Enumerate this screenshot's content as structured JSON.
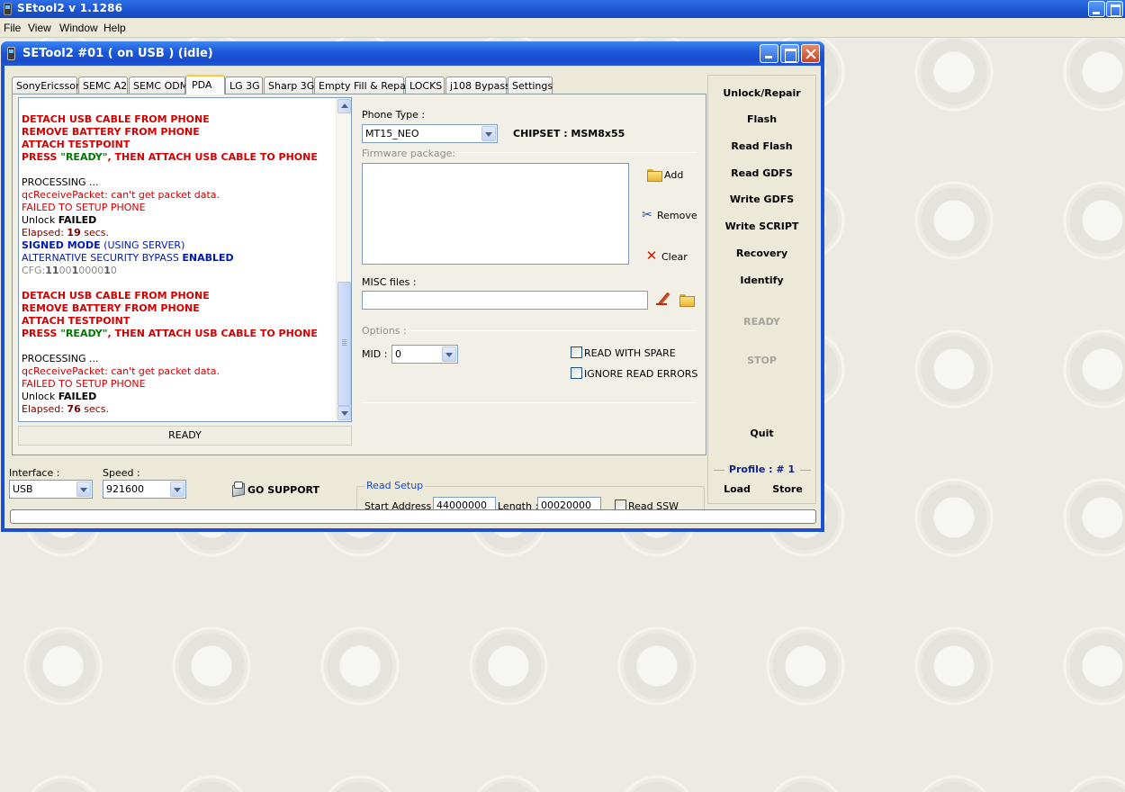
{
  "app": {
    "title": "SEtool2 v 1.1286",
    "menu": [
      "File",
      "View",
      "Window",
      "Help"
    ]
  },
  "window": {
    "title": "SETool2 #01 ( on USB ) (idle)"
  },
  "tabs": [
    "SonyEricsson",
    "SEMC A2",
    "SEMC ODM",
    "PDA",
    "LG 3G",
    "Sharp 3G",
    "Empty Fill & Repair",
    "LOCKS",
    "j108 Bypass",
    "Settings"
  ],
  "active_tab": "PDA",
  "log": {
    "l1": "DETACH USB CABLE FROM PHONE",
    "l2": "REMOVE BATTERY FROM PHONE",
    "l3": "ATTACH TESTPOINT",
    "l4a": "PRESS ",
    "l4b": "\"READY\"",
    "l4c": ", THEN ATTACH USB CABLE TO PHONE",
    "l5": "PROCESSING ...",
    "l6": "qcReceivePacket: can't get packet data.",
    "l7": "FAILED TO SETUP PHONE",
    "l8a": "Unlock ",
    "l8b": "FAILED",
    "l9a": "Elapsed: ",
    "l9b": "19",
    "l9c": " secs.",
    "l10a": "SIGNED MODE",
    "l10b": " (USING SERVER)",
    "l11a": "ALTERNATIVE SECURITY BYPASS ",
    "l11b": "ENABLED",
    "l12a": "CFG:",
    "l12b": "11",
    "l12c": "00",
    "l12d": "1",
    "l12e": "0000",
    "l12f": "1",
    "l12g": "0",
    "l13": "DETACH USB CABLE FROM PHONE",
    "l14": "REMOVE BATTERY FROM PHONE",
    "l15": "ATTACH TESTPOINT",
    "l16a": "PRESS ",
    "l16b": "\"READY\"",
    "l16c": ", THEN ATTACH USB CABLE TO PHONE",
    "l17": "PROCESSING ...",
    "l18": "qcReceivePacket: can't get packet data.",
    "l19": "FAILED TO SETUP PHONE",
    "l20a": "Unlock ",
    "l20b": "FAILED",
    "l21a": "Elapsed: ",
    "l21b": "76",
    "l21c": " secs."
  },
  "status_text": "READY",
  "pda": {
    "phone_type_label": "Phone Type :",
    "phone_type_value": "MT15_NEO",
    "chipset": "CHIPSET : MSM8x55",
    "firmware_label": "Firmware package:",
    "add_label": "Add",
    "remove_label": "Remove",
    "clear_label": "Clear",
    "misc_label": "MISC files :",
    "options_label": "Options :",
    "mid_label": "MID :",
    "mid_value": "0",
    "read_with_spare": "READ WITH SPARE",
    "ignore_read_errors": "IGNORE READ ERRORS"
  },
  "commands": {
    "unlock_repair": "Unlock/Repair",
    "flash": "Flash",
    "read_flash": "Read Flash",
    "read_gdfs": "Read GDFS",
    "write_gdfs": "Write GDFS",
    "write_script": "Write SCRIPT",
    "recovery": "Recovery",
    "identify": "Identify",
    "ready": "READY",
    "stop": "STOP",
    "quit": "Quit",
    "profile": "Profile :  # 1",
    "load": "Load",
    "store": "Store"
  },
  "bottom": {
    "interface_label": "Interface :",
    "interface_value": "USB",
    "speed_label": "Speed :",
    "speed_value": "921600",
    "go_support": "GO SUPPORT",
    "read_setup_title": "Read Setup",
    "start_address_label": "Start Address :",
    "start_address_value": "44000000",
    "length_label": "Length :",
    "length_value": "00020000",
    "read_ssw": "Read SSW"
  },
  "progress_fraction": 0
}
